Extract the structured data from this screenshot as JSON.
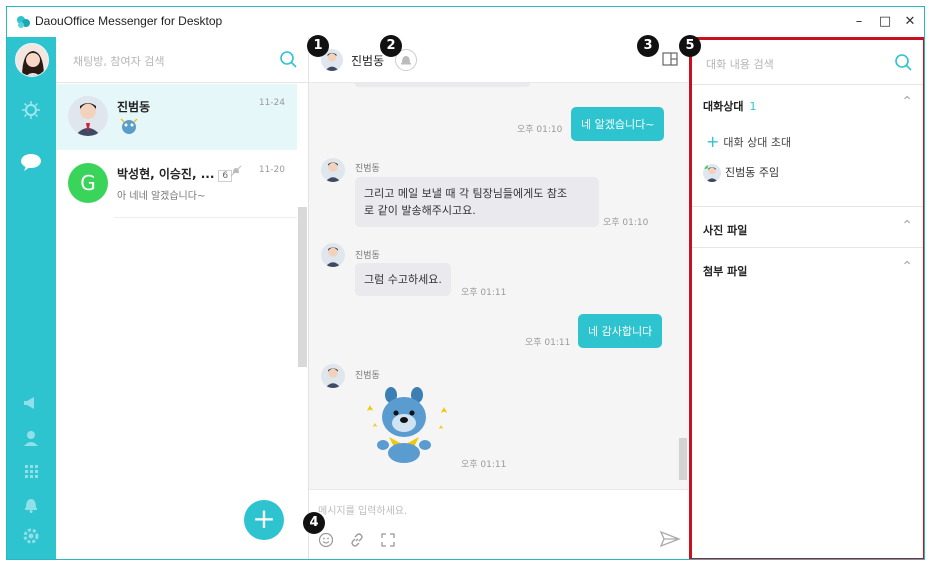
{
  "window": {
    "title": "DaouOffice Messenger for Desktop"
  },
  "roomlist": {
    "search_placeholder": "채팅방, 참여자 검색",
    "rooms": [
      {
        "name": "진범동",
        "time": "11-24",
        "preview": ""
      },
      {
        "name": "박성현, 이승진, ...",
        "count": "6",
        "time": "11-20",
        "preview": "아 네네 알겠습니다~",
        "avatar_letter": "G"
      }
    ]
  },
  "chat": {
    "header_name": "진범동",
    "messages": [
      {
        "from": "me",
        "text": "네 알겠습니다~",
        "time": "오후 01:10"
      },
      {
        "from": "other",
        "sender": "진범동",
        "text_line1": "그리고 메일 보낼 때 각 팀장님들에게도 참조",
        "text_line2": "로 같이 발송해주시고요.",
        "time": "오후 01:10"
      },
      {
        "from": "other",
        "sender": "진범동",
        "text": "그럼 수고하세요.",
        "time": "오후 01:11"
      },
      {
        "from": "me",
        "text": "네 감사합니다",
        "time": "오후 01:11"
      },
      {
        "from": "other",
        "sender": "진범동",
        "sticker": "bear-sticker",
        "time": "오후 01:11"
      }
    ],
    "composer_placeholder": "메시지를 입력하세요."
  },
  "panel": {
    "search_placeholder": "대화 내용 검색",
    "participants_title": "대화상대",
    "participants_count": "1",
    "invite_label": "대화 상대 초대",
    "member_label": "진범동 주임",
    "photos_title": "사진 파일",
    "files_title": "첨부 파일"
  },
  "callouts": [
    "1",
    "2",
    "3",
    "4",
    "5"
  ],
  "colors": {
    "accent": "#2dc3cf",
    "highlight_border": "#c8101e"
  }
}
